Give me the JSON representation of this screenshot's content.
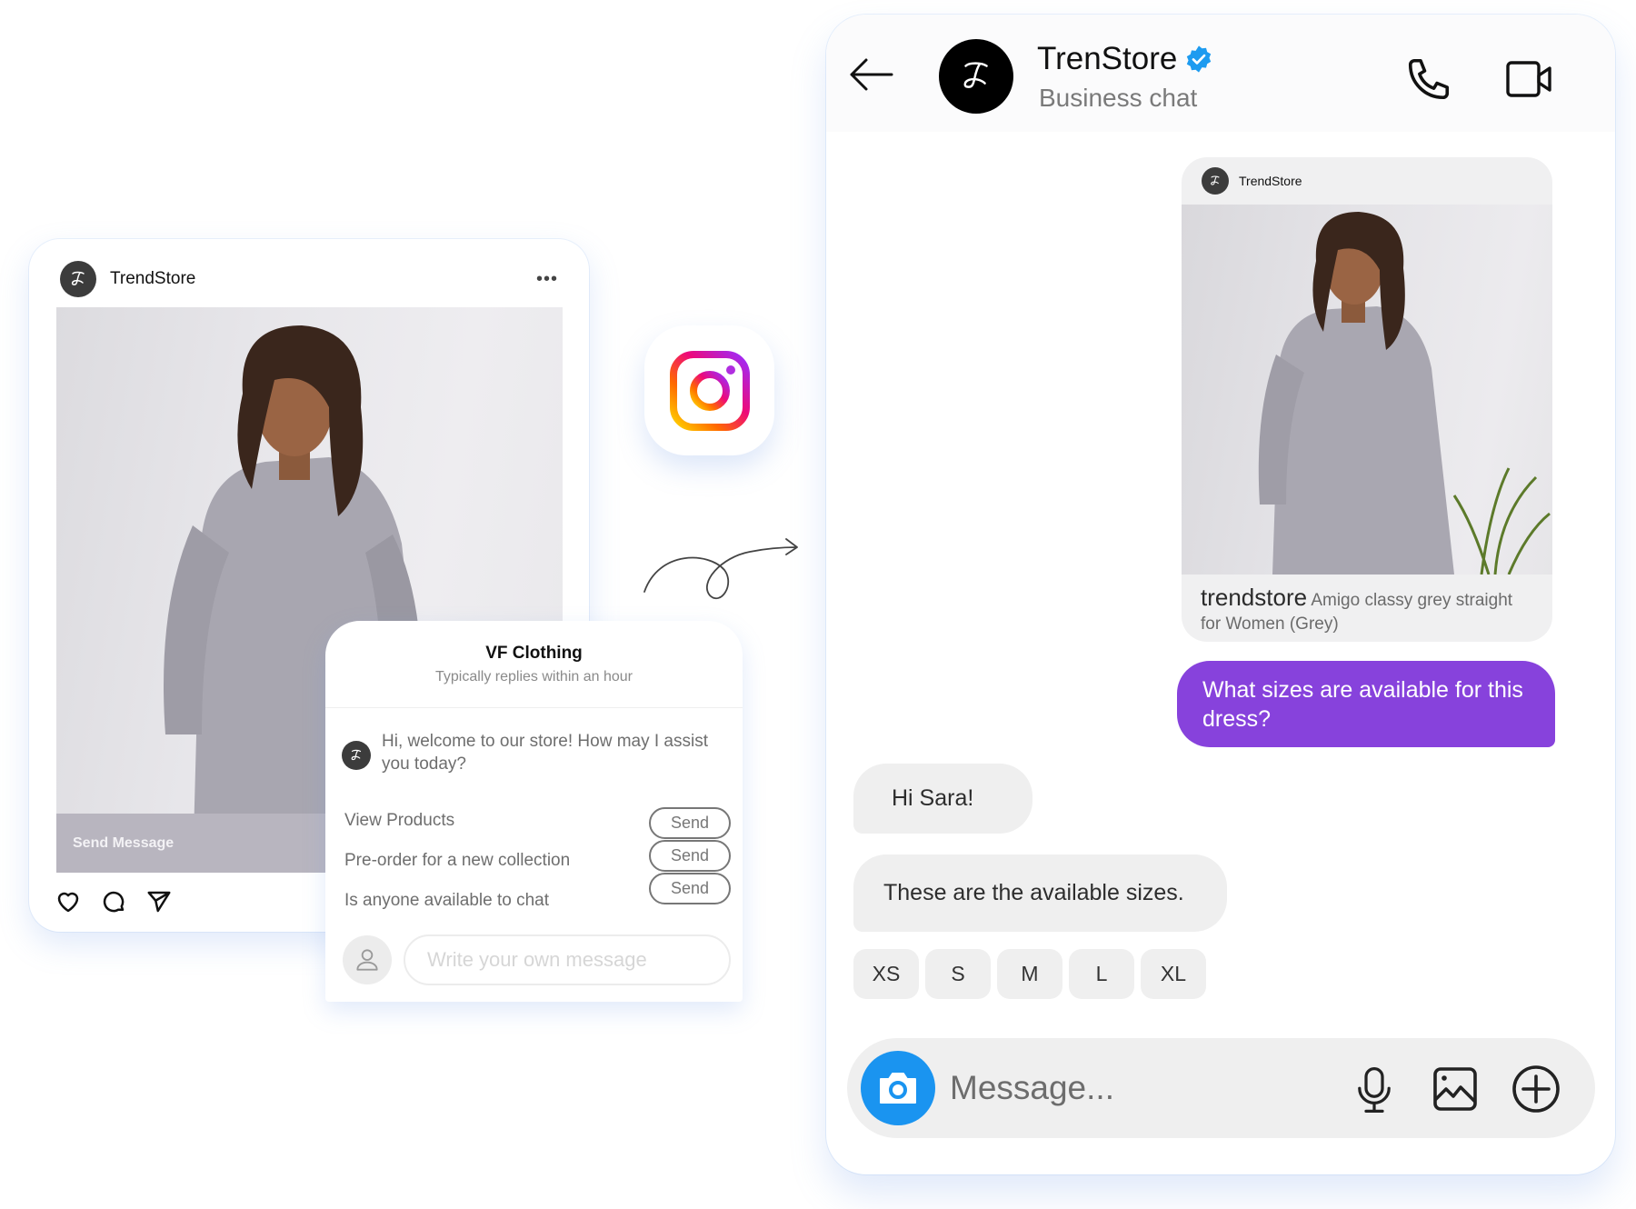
{
  "post": {
    "username": "TrendStore",
    "avatar_letter": "ᵏ",
    "avatar_glyph": "ƒ",
    "more_label": "•••",
    "send_message_label": "Send Message",
    "actions": [
      "heart-icon",
      "comment-icon",
      "share-icon"
    ]
  },
  "popup": {
    "title": "VF Clothing",
    "subtitle": "Typically replies within an hour",
    "welcome": "Hi, welcome to our store! How may I assist you today?",
    "options": [
      {
        "label": "View Products",
        "button": "Send"
      },
      {
        "label": "Pre-order for a new collection",
        "button": "Send"
      },
      {
        "label": "Is anyone available to chat",
        "button": "Send"
      }
    ],
    "input_placeholder": "Write your own message"
  },
  "chat": {
    "name": "TrenStore",
    "verified": true,
    "subtitle": "Business chat",
    "shared_post": {
      "username": "TrendStore",
      "caption_user": "trendstore",
      "caption_text": "Amigo classy grey straight for Women (Grey)"
    },
    "messages": [
      {
        "from": "user",
        "text": "What sizes are available for this dress?"
      },
      {
        "from": "business",
        "text": "Hi Sara!"
      },
      {
        "from": "business",
        "text": "These are the available sizes."
      }
    ],
    "sizes": [
      "XS",
      "S",
      "M",
      "L",
      "XL"
    ],
    "input_placeholder": "Message..."
  },
  "colors": {
    "accent_purple": "#8742dc",
    "camera_blue": "#1a94f0",
    "verified_blue": "#1d9bf0",
    "bubble_grey": "#efefef"
  }
}
